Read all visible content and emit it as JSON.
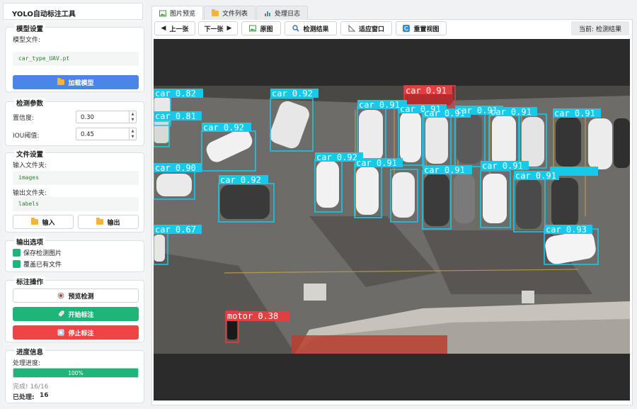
{
  "app": {
    "title": "YOLO自动标注工具"
  },
  "model": {
    "group_title": "模型设置",
    "file_label": "模型文件:",
    "file_value": "car_type_UAV.pt",
    "load_button": "加载模型"
  },
  "params": {
    "group_title": "检测参数",
    "conf_label": "置信度:",
    "conf_value": "0.30",
    "iou_label": "IOU阈值:",
    "iou_value": "0.45"
  },
  "files": {
    "group_title": "文件设置",
    "input_label": "输入文件夹:",
    "input_value": "images",
    "output_label": "输出文件夹:",
    "output_value": "labels",
    "input_button": "输入",
    "output_button": "输出"
  },
  "output_options": {
    "group_title": "输出选项",
    "save_images": "保存检测图片",
    "overwrite": "覆盖已有文件"
  },
  "actions": {
    "group_title": "标注操作",
    "preview": "预览检测",
    "start": "开始标注",
    "stop": "停止标注"
  },
  "progress": {
    "group_title": "进度信息",
    "label": "处理进度:",
    "percent_text": "100%",
    "percent": 100,
    "done_text": "完成! 16/16",
    "processed_label": "已处理:",
    "processed_value": "16"
  },
  "tabs": [
    {
      "label": "图片预览",
      "icon": "image-icon"
    },
    {
      "label": "文件列表",
      "icon": "folder-icon"
    },
    {
      "label": "处理日志",
      "icon": "chart-icon"
    }
  ],
  "toolbar": {
    "prev": "上一张",
    "next": "下一张",
    "original": "原图",
    "detect": "检测结果",
    "fit": "适应窗口",
    "reset": "重置视图",
    "status": "当前: 检测结果"
  },
  "detections": [
    {
      "label": "car 0.82"
    },
    {
      "label": "car 0.81"
    },
    {
      "label": "car 0.92"
    },
    {
      "label": "car 0.92"
    },
    {
      "label": "car 0.90"
    },
    {
      "label": "car 0.92"
    },
    {
      "label": "car 0.67"
    },
    {
      "label": "car 0.91"
    },
    {
      "label": "car 0.91"
    },
    {
      "label": "car 0.91"
    },
    {
      "label": "car 0.91"
    },
    {
      "label": "car 0.91"
    },
    {
      "label": "car 0.91"
    },
    {
      "label": "car 0.92"
    },
    {
      "label": "car 0.91"
    },
    {
      "label": "car 0.91"
    },
    {
      "label": "car 0.91"
    },
    {
      "label": "car 0.91"
    },
    {
      "label": "car 0.91"
    },
    {
      "label": "car 0.93"
    },
    {
      "label": "motor 0.38"
    }
  ],
  "colors": {
    "accent_blue": "#4a86e8",
    "green": "#1fb57a",
    "red": "#ee4444",
    "box_cyan": "#17c8e8",
    "box_red": "#e04040"
  }
}
